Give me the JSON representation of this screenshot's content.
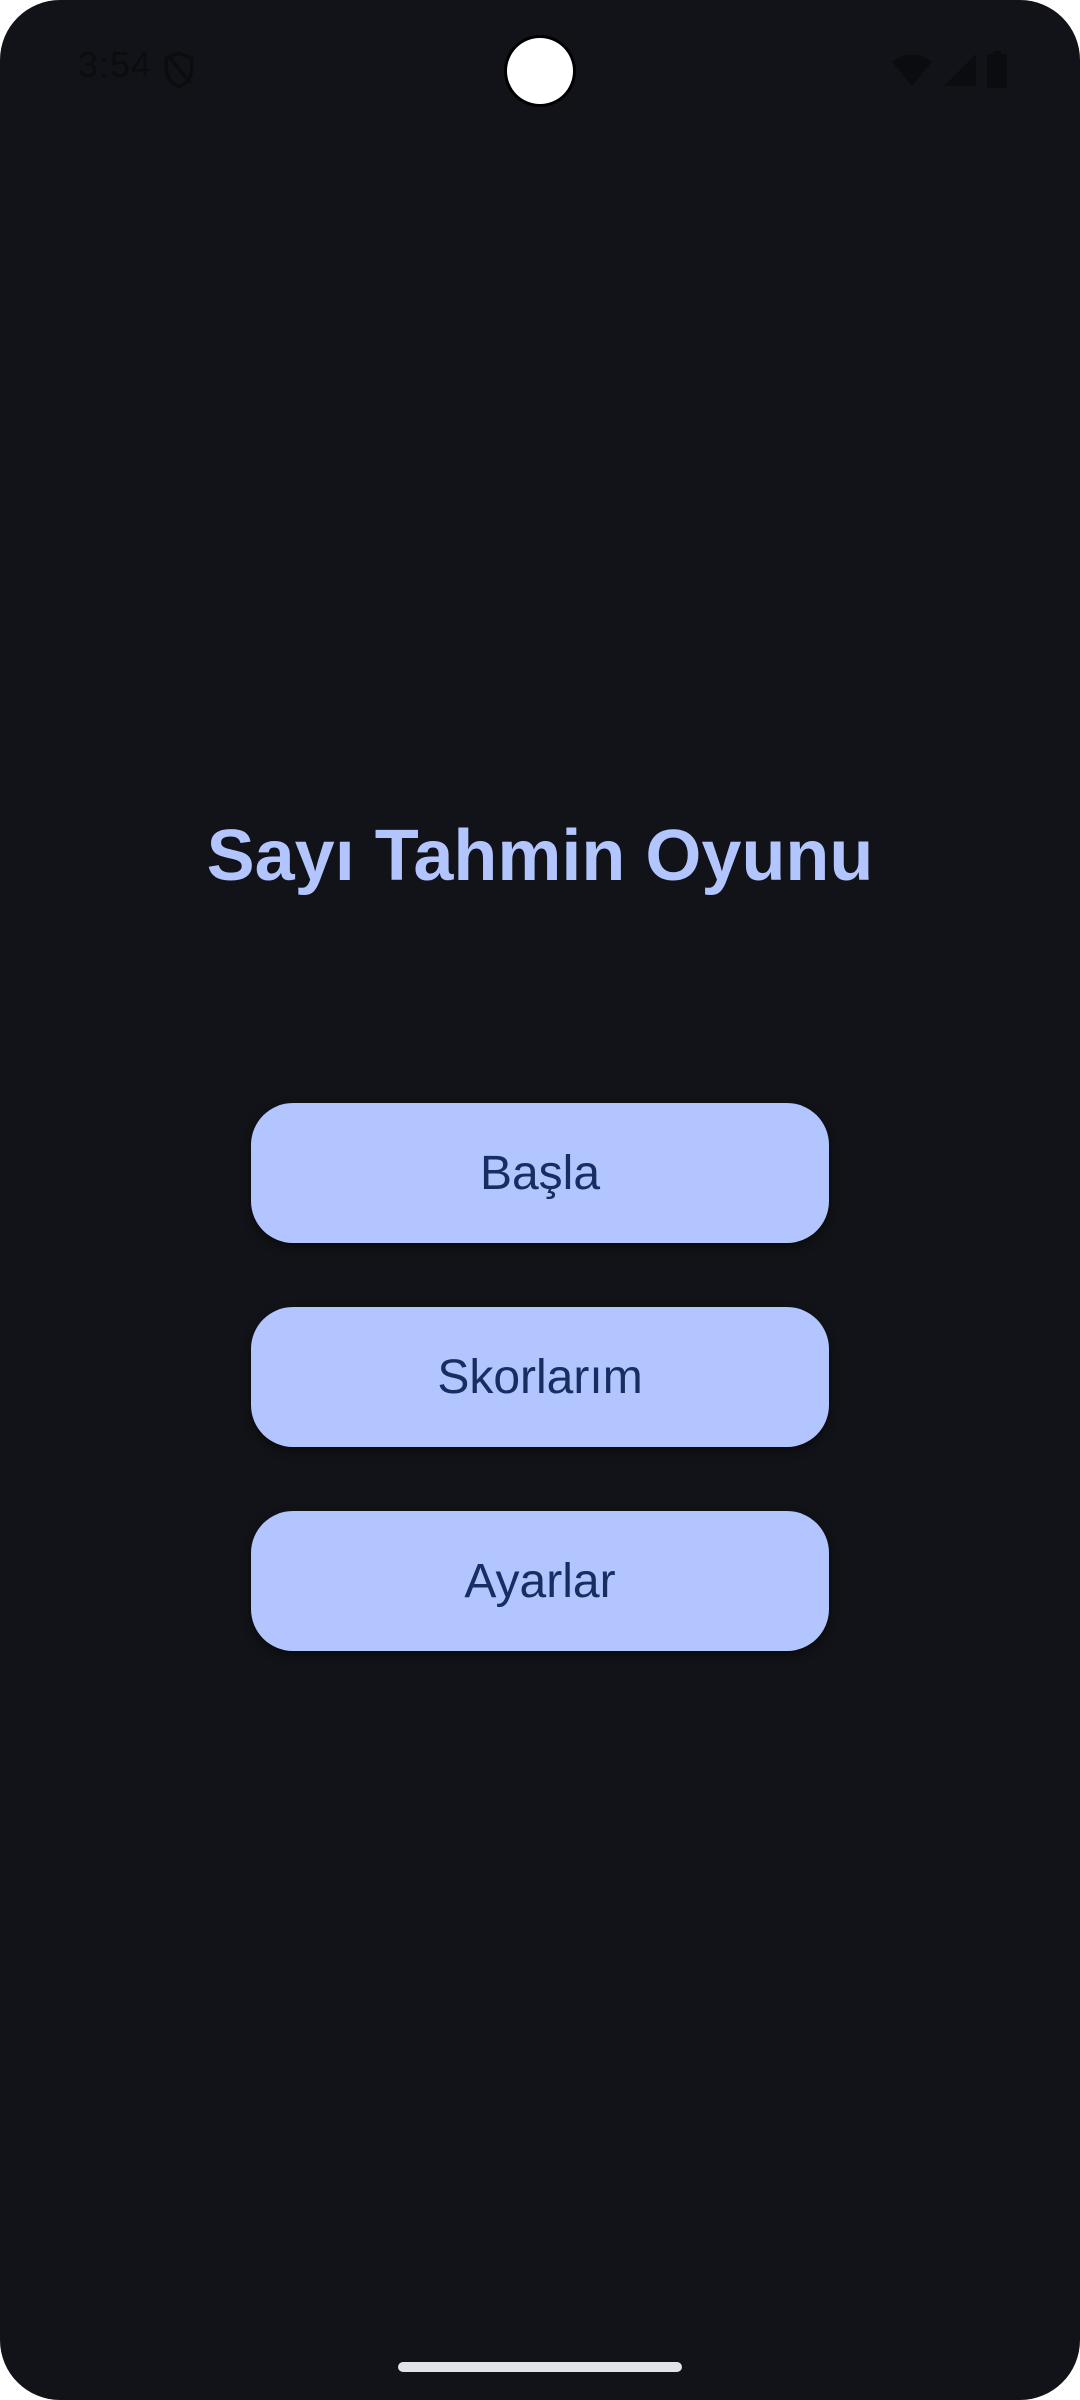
{
  "status_bar": {
    "time": "3:54",
    "icons": [
      "shield-icon",
      "wifi-icon",
      "cellular-signal-icon",
      "battery-icon"
    ]
  },
  "main": {
    "title": "Sayı Tahmin Oyunu",
    "buttons": {
      "start_label": "Başla",
      "scores_label": "Skorlarım",
      "settings_label": "Ayarlar"
    }
  },
  "colors": {
    "background": "#121318",
    "accent": "#b2c5ff",
    "button_text": "#182e60"
  }
}
